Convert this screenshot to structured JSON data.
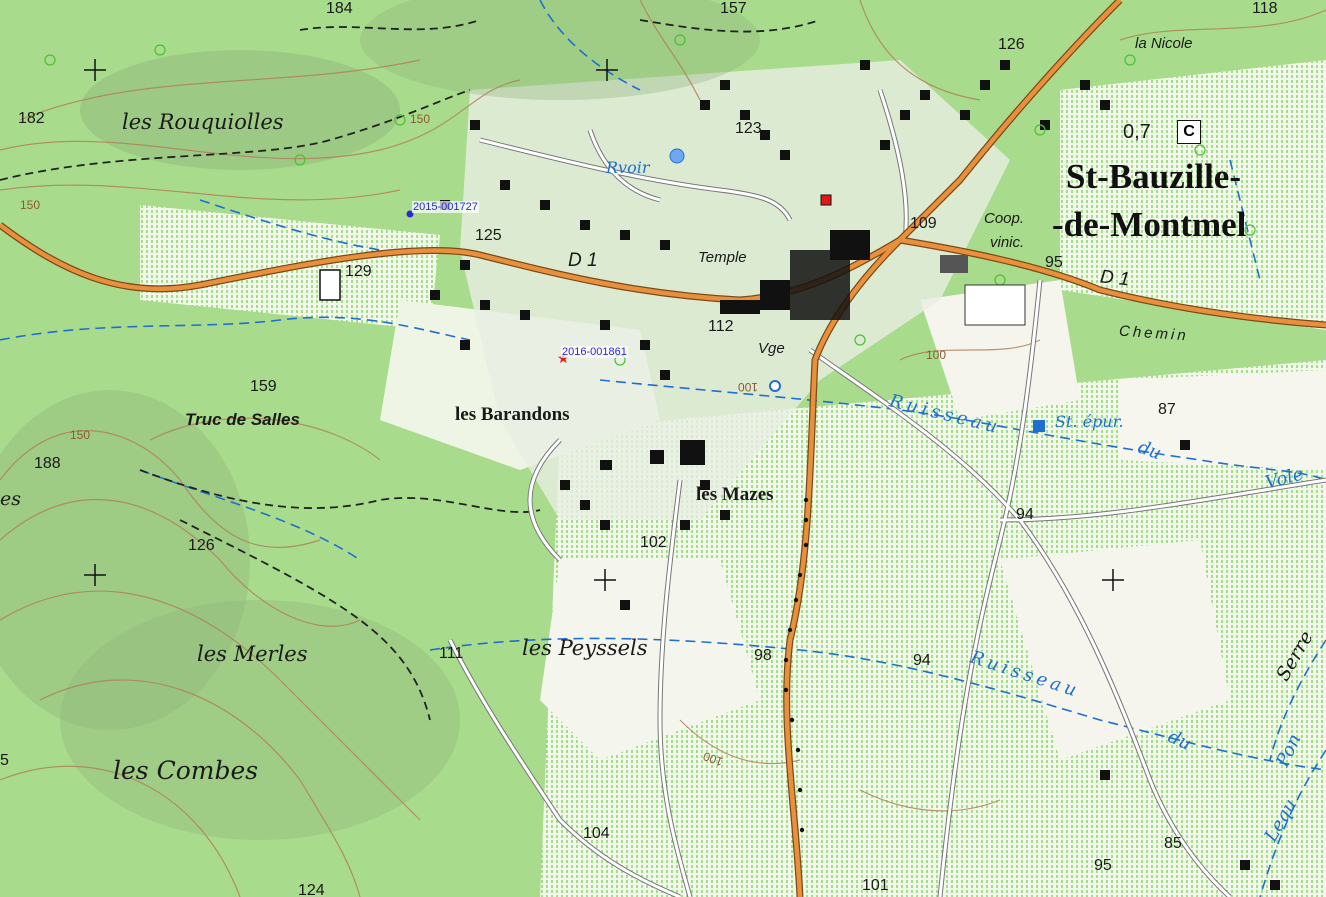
{
  "map": {
    "town_name": [
      "St-Bauzille-",
      "-de-Montmel"
    ],
    "place_names": {
      "rouquiolles": "les Rouquiolles",
      "truc_de_salles": "Truc de Salles",
      "barandons": "les Barandons",
      "mazes": "les Mazes",
      "peyssels": "les Peyssels",
      "merles": "les Merles",
      "combes": "les Combes",
      "nicole": "la Nicole",
      "temple": "Temple",
      "vge": "Vge",
      "rvoir": "Rvoir",
      "coop_line1": "Coop.",
      "coop_line2": "vinic.",
      "st_epur": "St. épur.",
      "chemin": "Chemin",
      "serre": "Serre",
      "es": "es"
    },
    "water_names": {
      "ruisseau_1": "Ruisseau",
      "du_1": "du",
      "volet": "Vole",
      "ruisseau_2": "Ruisseau",
      "du_2": "du",
      "pont": "Pon",
      "lequ": "Lequ"
    },
    "roads": {
      "d1_west": "D 1",
      "d1_east": "D 1"
    },
    "elevations": {
      "e182": "182",
      "e129": "129",
      "e125": "125",
      "e123": "123",
      "e126a": "126",
      "e109": "109",
      "e95a": "95",
      "e87": "87",
      "e118": "118",
      "e157": "157",
      "e184": "184",
      "e159": "159",
      "e188": "188",
      "e126b": "126",
      "e112": "112",
      "e102": "102",
      "e94a": "94",
      "e94b": "94",
      "e98": "98",
      "e111": "111",
      "e104": "104",
      "e124": "124",
      "e101": "101",
      "e85": "85",
      "e95b": "95",
      "e5": "5",
      "contour_150a": "150",
      "contour_150b": "150",
      "contour_150c": "150",
      "contour_100a": "100",
      "contour_100b": "100",
      "contour_100c": "100",
      "e07": "0,7"
    },
    "c_symbol": "C",
    "markers": [
      {
        "id": "m1",
        "label": "2015-001727",
        "color": "#2a2ad0"
      },
      {
        "id": "m2",
        "label": "2016-001861",
        "color": "#e01818"
      }
    ],
    "colors": {
      "forest": "#a8dc8c",
      "forest_dark": "#8ecf72",
      "road": "#e8903c",
      "water": "#1f6fd0",
      "contour": "#b0825a",
      "building": "#111111"
    }
  }
}
